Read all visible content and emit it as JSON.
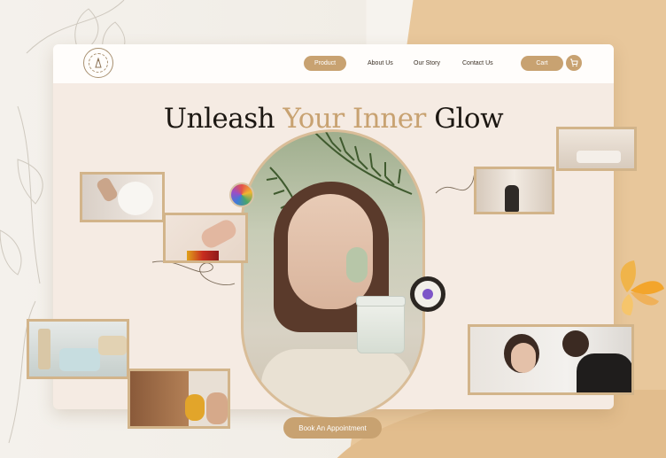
{
  "nav": {
    "product_label": "Product",
    "about_label": "About Us",
    "story_label": "Our Story",
    "contact_label": "Contact Us",
    "cart_label": "Cart"
  },
  "hero": {
    "headline_start": "Unleash ",
    "headline_accent": "Your Inner",
    "headline_end": " Glow"
  },
  "cta": {
    "label": "Book An Appointment"
  },
  "colors": {
    "accent": "#c8a271",
    "window_bg": "#f5ebe3",
    "backdrop_tan": "#e8c79b",
    "text": "#1c1712"
  },
  "icons": {
    "cart": "cart-icon",
    "logo": "logo-emblem-icon"
  }
}
